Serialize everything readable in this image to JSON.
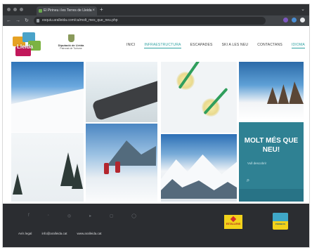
{
  "browser": {
    "tab_title": "El Pirineu i les Terres de Lleida",
    "tab_close": "×",
    "new_tab": "+",
    "url": "esquiu.aralleida.com/ca/molt_mes_que_neu.php",
    "nav_icons": [
      "back-icon",
      "forward-icon",
      "reload-icon"
    ]
  },
  "header": {
    "logo_text": "Lleida",
    "diputacio_line1": "Diputació de Lleida",
    "diputacio_line2": "Patronat de Turisme",
    "menu": [
      {
        "label": "INICI"
      },
      {
        "label": "INFRAESTRUCTURA"
      },
      {
        "label": "ESCAPADES"
      },
      {
        "label": "SKI A LES NEU"
      },
      {
        "label": "CONTACTANS"
      },
      {
        "label": "IDIOMA"
      }
    ]
  },
  "promo": {
    "title_line1": "MOLT MÉS QUE",
    "title_line2": "NEU!",
    "link": "Vull descobrir"
  },
  "footer": {
    "links": [
      "Avís legal",
      "info@aralleida.cat",
      "www.aralleida.cat"
    ],
    "badge1": "ESTALLENS",
    "badge2": "PIRINEUS"
  },
  "colors": {
    "accent": "#2ea1a1",
    "promo_bg": "#2f8193",
    "footer_bg": "#2b2d31"
  }
}
